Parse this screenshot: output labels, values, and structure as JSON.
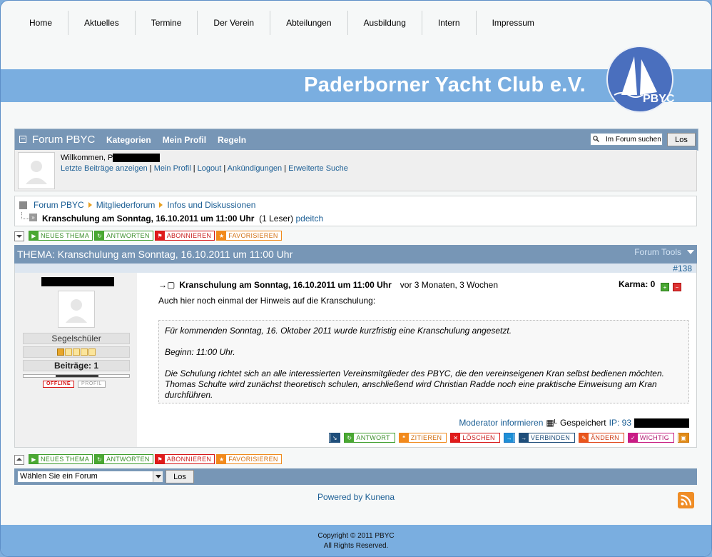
{
  "nav": [
    "Home",
    "Aktuelles",
    "Termine",
    "Der Verein",
    "Abteilungen",
    "Ausbildung",
    "Intern",
    "Impressum"
  ],
  "banner": {
    "title": "Paderborner Yacht Club e.V.",
    "logo_text": "PBYC"
  },
  "forum_header": {
    "title": "Forum PBYC",
    "menu": [
      "Kategorien",
      "Mein Profil",
      "Regeln"
    ],
    "search_placeholder": "Im Forum suchen",
    "search_button": "Los"
  },
  "welcome": {
    "greeting": "Willkommen, P",
    "links": [
      "Letzte Beiträge anzeigen",
      "Mein Profil",
      "Logout",
      "Ankündigungen",
      "Erweiterte Suche"
    ]
  },
  "breadcrumb": {
    "items": [
      "Forum PBYC",
      "Mitgliederforum",
      "Infos und Diskussionen"
    ],
    "topic": "Kranschulung am Sonntag, 16.10.2011 um 11:00 Uhr",
    "readers": "(1 Leser)",
    "user": "pdeitch"
  },
  "toolbar": [
    "NEUES THEMA",
    "ANTWORTEN",
    "ABONNIEREN",
    "FAVORISIEREN"
  ],
  "topic": {
    "title": "THEMA: Kranschulung am Sonntag, 16.10.2011 um 11:00 Uhr",
    "tools": "Forum Tools"
  },
  "post": {
    "number": "#138",
    "rank": "Segelschüler",
    "rank_stars": 1,
    "posts": "Beiträge: 1",
    "status_offline": "OFFLINE",
    "status_profile": "PROFIL",
    "subject": "Kranschulung am Sonntag, 16.10.2011 um 11:00 Uhr",
    "ago": "vor 3 Monaten, 3 Wochen",
    "karma": "Karma: 0",
    "intro": "Auch hier noch einmal der Hinweis auf die Kranschulung:",
    "quote": [
      "Für kommenden Sonntag, 16. Oktober 2011 wurde kurzfristig eine Kranschulung angesetzt.",
      "Beginn: 11:00 Uhr.",
      "Die Schulung richtet sich an alle interessierten Vereinsmitglieder des PBYC, die den vereinseigenen Kran selbst bedienen möchten. Thomas Schulte wird zunächst theoretisch schulen, anschließend wird Christian Radde noch eine praktische Einweisung am Kran durchführen."
    ],
    "moderator": "Moderator informieren",
    "saved": "Gespeichert",
    "ip": "IP: 93",
    "actions": [
      "ANTWORT",
      "ZITIEREN",
      "LÖSCHEN",
      "VERBINDEN",
      "ÄNDERN",
      "WICHTIG"
    ]
  },
  "forum_select": {
    "value": "Wählen Sie ein Forum",
    "button": "Los"
  },
  "powered": "Powered by Kunena",
  "footer": {
    "line1": "Copyright © 2011 PBYC",
    "line2": "All Rights Reserved."
  }
}
